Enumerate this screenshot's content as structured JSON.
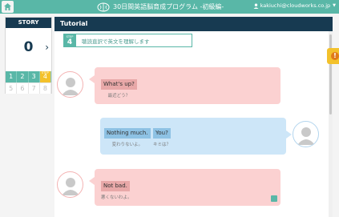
{
  "header": {
    "brand_title": "30日間英語脳育成プログラム -初級編-",
    "account_email": "kakiuchi@cloudworks.co.jp"
  },
  "story": {
    "heading": "STORY",
    "number": "0",
    "steps_row1": [
      "1",
      "2",
      "3",
      "4"
    ],
    "steps_row2": [
      "5",
      "6",
      "7",
      "8"
    ],
    "active_step_tag": "STEP"
  },
  "main": {
    "title": "Tutorial",
    "step_small": "STEP",
    "step_number": "4",
    "step_text": "聴読直訳で英文を理解します"
  },
  "dialogue": [
    {
      "side": "left",
      "phrases": [
        {
          "en": "What's up?",
          "ja": "最近どう？"
        }
      ]
    },
    {
      "side": "right",
      "phrases": [
        {
          "en": "Nothing much.",
          "ja": "変わりないよ。"
        },
        {
          "en": "You?",
          "ja": "キミは？"
        }
      ]
    },
    {
      "side": "left",
      "phrases": [
        {
          "en": "Not bad.",
          "ja": "悪くないわよ。"
        }
      ]
    }
  ],
  "colors": {
    "header_teal": "#59b7a7",
    "navy": "#173a51",
    "accent_yellow": "#f3c12b",
    "bubble_pink": "#fbd1d1",
    "bubble_blue": "#cde6f8"
  }
}
